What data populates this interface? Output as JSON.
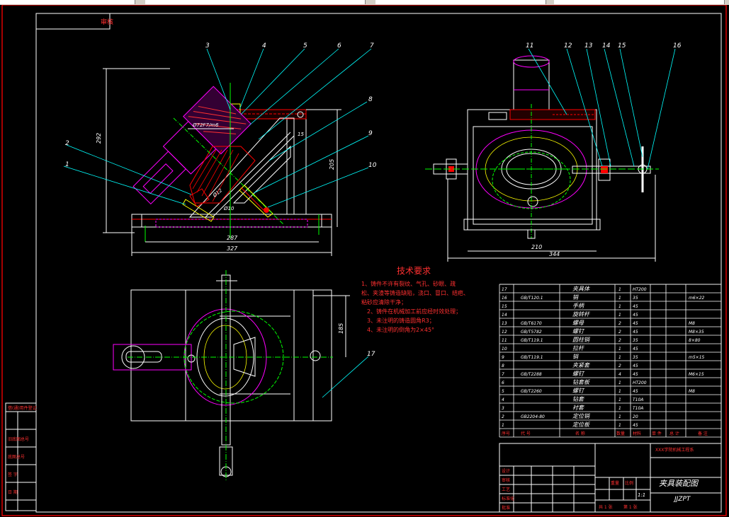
{
  "window": {
    "tabs": [
      "",
      "",
      "",
      ""
    ]
  },
  "title_box": {
    "stamp": "审核"
  },
  "view_front": {
    "dims": [
      "292",
      "205",
      "287",
      "327",
      "Ø72F7/m6",
      "Ø10",
      "Ø12",
      "15"
    ],
    "leaders": [
      "1",
      "2",
      "3",
      "4",
      "5",
      "6",
      "7",
      "8",
      "9",
      "10"
    ]
  },
  "view_side": {
    "dims": [
      "210",
      "344"
    ],
    "leaders": [
      "11",
      "12",
      "13",
      "14",
      "15",
      "16"
    ]
  },
  "view_top": {
    "dims": [
      "185"
    ],
    "leaders": [
      "17"
    ]
  },
  "tech_req": {
    "title": "技术要求",
    "lines": [
      "1、铸件不许有裂纹、气孔、砂眼、疏",
      "松、夹渣等铸造缺陷，浇口、冒口、结疤、",
      "粘砂应清除干净；",
      "2、铸件在机械加工前应经时效处理；",
      "3、未注明的铸造圆角R3；",
      "4、未注明的倒角为2×45°"
    ]
  },
  "bom": {
    "rows": [
      {
        "no": "17",
        "code": "",
        "name": "夹具体",
        "qty": "1",
        "mat": "HT200",
        "note": ""
      },
      {
        "no": "16",
        "code": "GB/T120.1",
        "name": "销",
        "qty": "1",
        "mat": "35",
        "note": "m6×22"
      },
      {
        "no": "15",
        "code": "",
        "name": "手柄",
        "qty": "1",
        "mat": "45",
        "note": ""
      },
      {
        "no": "14",
        "code": "",
        "name": "旋转杆",
        "qty": "1",
        "mat": "45",
        "note": ""
      },
      {
        "no": "13",
        "code": "GB/T6170",
        "name": "螺母",
        "qty": "2",
        "mat": "45",
        "note": "M8"
      },
      {
        "no": "12",
        "code": "GB/T5782",
        "name": "螺钉",
        "qty": "2",
        "mat": "45",
        "note": "M8×35"
      },
      {
        "no": "11",
        "code": "GB/T119.1",
        "name": "圆柱销",
        "qty": "2",
        "mat": "35",
        "note": "8×80"
      },
      {
        "no": "10",
        "code": "",
        "name": "拉杆",
        "qty": "1",
        "mat": "45",
        "note": ""
      },
      {
        "no": "9",
        "code": "GB/T119.1",
        "name": "销",
        "qty": "1",
        "mat": "35",
        "note": "m5×15"
      },
      {
        "no": "8",
        "code": "",
        "name": "夹紧套",
        "qty": "2",
        "mat": "45",
        "note": ""
      },
      {
        "no": "7",
        "code": "GB/T2288",
        "name": "螺钉",
        "qty": "4",
        "mat": "45",
        "note": "M6×15"
      },
      {
        "no": "6",
        "code": "",
        "name": "钻套板",
        "qty": "1",
        "mat": "HT200",
        "note": ""
      },
      {
        "no": "5",
        "code": "GB/T2260",
        "name": "螺钉",
        "qty": "1",
        "mat": "45",
        "note": "M8"
      },
      {
        "no": "4",
        "code": "",
        "name": "钻套",
        "qty": "1",
        "mat": "T10A",
        "note": ""
      },
      {
        "no": "3",
        "code": "",
        "name": "衬套",
        "qty": "1",
        "mat": "T10A",
        "note": ""
      },
      {
        "no": "2",
        "code": "GB2204-80",
        "name": "定位销",
        "qty": "1",
        "mat": "20",
        "note": ""
      },
      {
        "no": "1",
        "code": "",
        "name": "定位板",
        "qty": "1",
        "mat": "45",
        "note": ""
      }
    ],
    "header": {
      "no": "序号",
      "code": "代 号",
      "name": "名 称",
      "qty": "数量",
      "mat": "材料",
      "weight": "单 件",
      "total": "总 计",
      "note": "备 注"
    }
  },
  "title_block": {
    "drawing_name": "夹具装配图",
    "drawing_code": "JJZPT",
    "school": "XXX学院机械工程系",
    "scale": "1:1",
    "sheet_total": "共 1 张",
    "sheet_no": "第 1 张",
    "mass_label": "重量",
    "ratio_label": "比例",
    "design": "设计",
    "check": "审核",
    "approve": "批准",
    "process": "工艺",
    "standard": "标准化"
  },
  "left_strip": [
    "借(通)用件登记",
    "旧底图总号",
    "底图总号",
    "签 字",
    "日 期"
  ],
  "colors": {
    "red": "#ff0000",
    "magenta": "#ff00ff",
    "cyan": "#00ffff",
    "green": "#00ff00",
    "white": "#ffffff",
    "yellow": "#ffff00"
  }
}
